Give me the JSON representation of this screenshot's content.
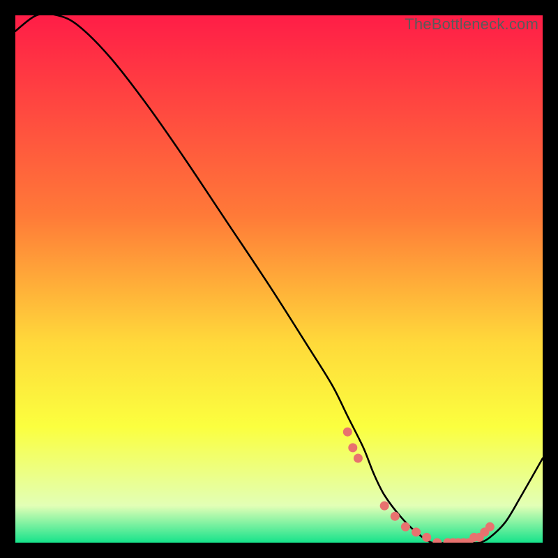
{
  "watermark": "TheBottleneck.com",
  "colors": {
    "top": "#ff1d47",
    "mid1": "#ff7a38",
    "mid2": "#ffd93a",
    "mid3": "#fbff3f",
    "mid4": "#e2ffb6",
    "bottom": "#16e38b",
    "curve": "#000000",
    "dot": "#e8726f"
  },
  "chart_data": {
    "type": "line",
    "title": "",
    "xlabel": "",
    "ylabel": "",
    "xlim": [
      0,
      100
    ],
    "ylim": [
      0,
      100
    ],
    "series": [
      {
        "name": "bottleneck-curve",
        "x": [
          0,
          4,
          8,
          12,
          18,
          25,
          32,
          40,
          48,
          55,
          60,
          63,
          66,
          68,
          70,
          73,
          76,
          79,
          82,
          84,
          86,
          88,
          90,
          93,
          96,
          100
        ],
        "y": [
          97,
          100,
          100,
          98,
          92,
          83,
          73,
          61,
          49,
          38,
          30,
          24,
          18,
          13,
          9,
          5,
          2,
          0,
          0,
          0,
          0,
          0,
          1,
          4,
          9,
          16
        ]
      }
    ],
    "markers": {
      "name": "highlight-dots",
      "x": [
        63,
        64,
        65,
        70,
        72,
        74,
        76,
        78,
        80,
        82,
        83,
        84,
        85,
        86,
        87,
        88,
        89,
        90
      ],
      "y": [
        21,
        18,
        16,
        7,
        5,
        3,
        2,
        1,
        0,
        0,
        0,
        0,
        0,
        0,
        1,
        1,
        2,
        3
      ]
    },
    "gradient_stops": [
      {
        "offset": 0.0,
        "color_key": "top"
      },
      {
        "offset": 0.38,
        "color_key": "mid1"
      },
      {
        "offset": 0.62,
        "color_key": "mid2"
      },
      {
        "offset": 0.78,
        "color_key": "mid3"
      },
      {
        "offset": 0.93,
        "color_key": "mid4"
      },
      {
        "offset": 1.0,
        "color_key": "bottom"
      }
    ]
  }
}
